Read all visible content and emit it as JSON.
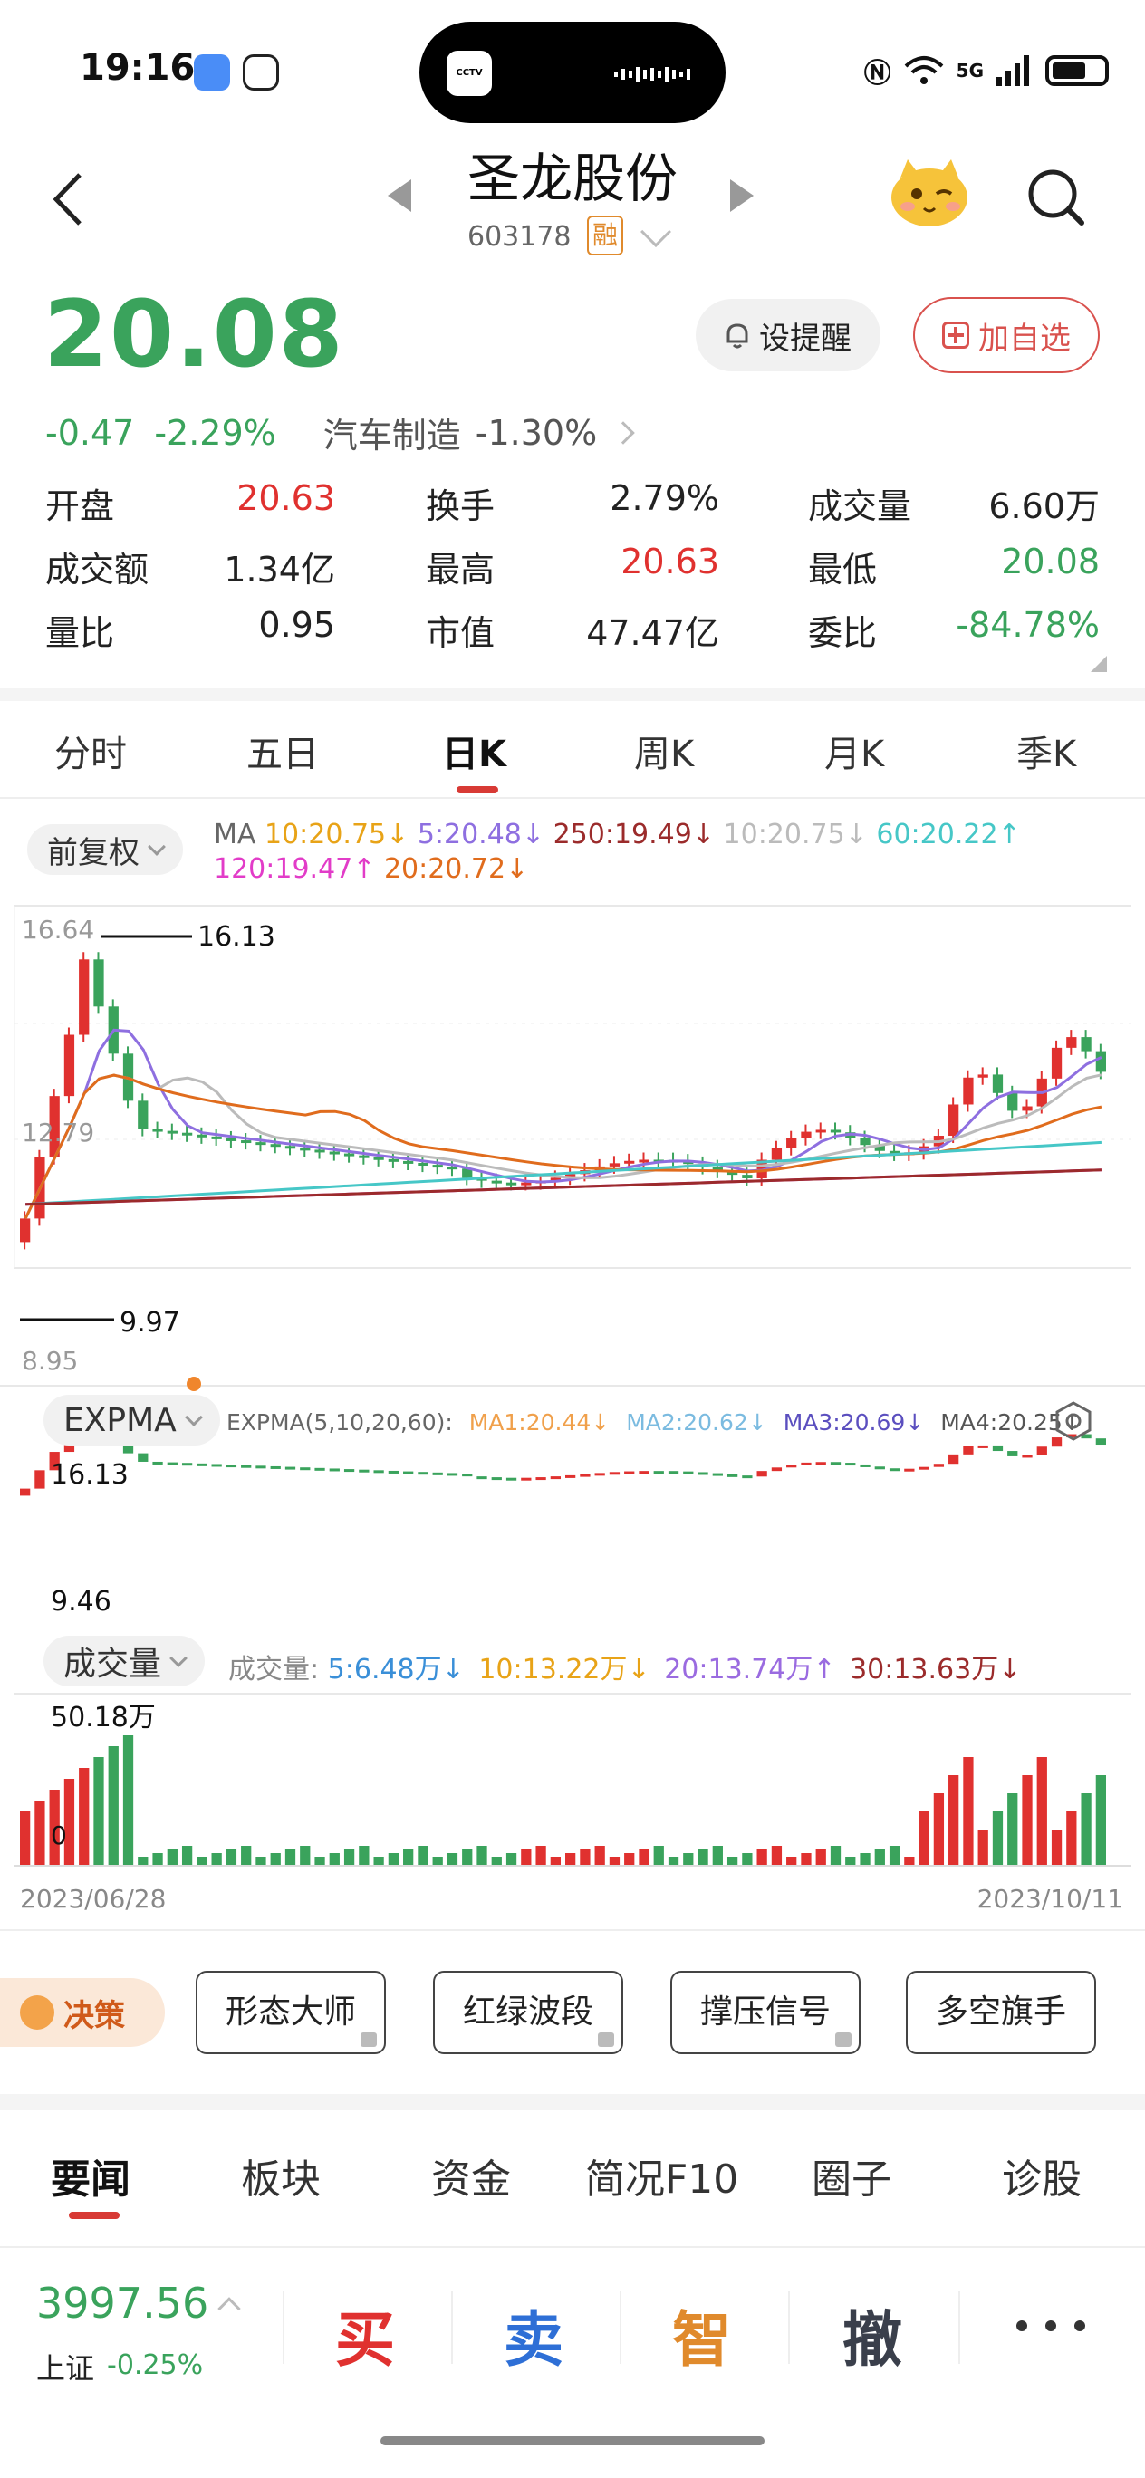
{
  "status_bar": {
    "time": "19:16",
    "network": "5G"
  },
  "header": {
    "stock_name": "圣龙股份",
    "stock_code": "603178",
    "margin_badge": "融"
  },
  "quote": {
    "price": "20.08",
    "change": "-0.47",
    "change_pct": "-2.29%",
    "industry": "汽车制造",
    "industry_change": "-1.30%",
    "alert_button": "设提醒",
    "fav_button": "加自选"
  },
  "stats": [
    {
      "label": "开盘",
      "value": "20.63",
      "color": "#e0312f"
    },
    {
      "label": "换手",
      "value": "2.79%",
      "color": "#222222"
    },
    {
      "label": "成交量",
      "value": "6.60万",
      "color": "#222222"
    },
    {
      "label": "成交额",
      "value": "1.34亿",
      "color": "#222222"
    },
    {
      "label": "最高",
      "value": "20.63",
      "color": "#e0312f"
    },
    {
      "label": "最低",
      "value": "20.08",
      "color": "#3aa35c"
    },
    {
      "label": "量比",
      "value": "0.95",
      "color": "#222222"
    },
    {
      "label": "市值",
      "value": "47.47亿",
      "color": "#222222"
    },
    {
      "label": "委比",
      "value": "-84.78%",
      "color": "#3aa35c"
    }
  ],
  "period_tabs": [
    "分时",
    "五日",
    "日K",
    "周K",
    "月K",
    "季K"
  ],
  "active_period": "日K",
  "adjust": "前复权",
  "ma_legend": {
    "prefix": "MA",
    "items": [
      {
        "text": "10:20.75↓",
        "color": "#e8a317"
      },
      {
        "text": "5:20.48↓",
        "color": "#8e6fe0"
      },
      {
        "text": "250:19.49↓",
        "color": "#9b2b2b"
      },
      {
        "text": "10:20.75↓",
        "color": "#bbbbbb"
      },
      {
        "text": "60:20.22↑",
        "color": "#46c7c7"
      },
      {
        "text": "120:19.47↑",
        "color": "#e23cc8"
      },
      {
        "text": "20:20.72↓",
        "color": "#e06c1d"
      }
    ]
  },
  "kline": {
    "axis_top": "16.64",
    "axis_mid": "12.79",
    "axis_bottom": "8.95",
    "high_marker": "16.13",
    "low_marker": "9.97"
  },
  "expma": {
    "pill": "EXPMA",
    "params": "EXPMA(5,10,20,60):",
    "items": [
      {
        "text": "MA1:20.44↓",
        "color": "#f0a04b"
      },
      {
        "text": "MA2:20.62↓",
        "color": "#7bbbe0"
      },
      {
        "text": "MA3:20.69↓",
        "color": "#5b4fbf"
      },
      {
        "text": "MA4:20.25↓",
        "color": "#555555"
      }
    ],
    "high_label": "16.13",
    "low_label": "9.46"
  },
  "volume": {
    "pill": "成交量",
    "prefix": "成交量:",
    "items": [
      {
        "text": "5:6.48万↓",
        "color": "#3a8fd8"
      },
      {
        "text": "10:13.22万↓",
        "color": "#e8a317"
      },
      {
        "text": "20:13.74万↑",
        "color": "#9a6be0"
      },
      {
        "text": "30:13.63万↓",
        "color": "#9b2b2b"
      }
    ],
    "max_label": "50.18万",
    "zero_label": "0"
  },
  "dates": {
    "start": "2023/06/28",
    "end": "2023/10/11"
  },
  "tools": {
    "featured": "决策",
    "buttons": [
      "形态大师",
      "红绿波段",
      "撑压信号",
      "多空旗手"
    ]
  },
  "news_tabs": [
    "要闻",
    "板块",
    "资金",
    "简况F10",
    "圈子",
    "诊股"
  ],
  "active_news_tab": "要闻",
  "bottom": {
    "index_value": "3997.56",
    "index_name": "上证",
    "index_change": "-0.25%",
    "actions": [
      {
        "label": "买",
        "color": "#e0312f"
      },
      {
        "label": "卖",
        "color": "#2e6fd6"
      },
      {
        "label": "智",
        "color": "#e08a2c"
      },
      {
        "label": "撤",
        "color": "#3a3f4b"
      }
    ]
  }
}
